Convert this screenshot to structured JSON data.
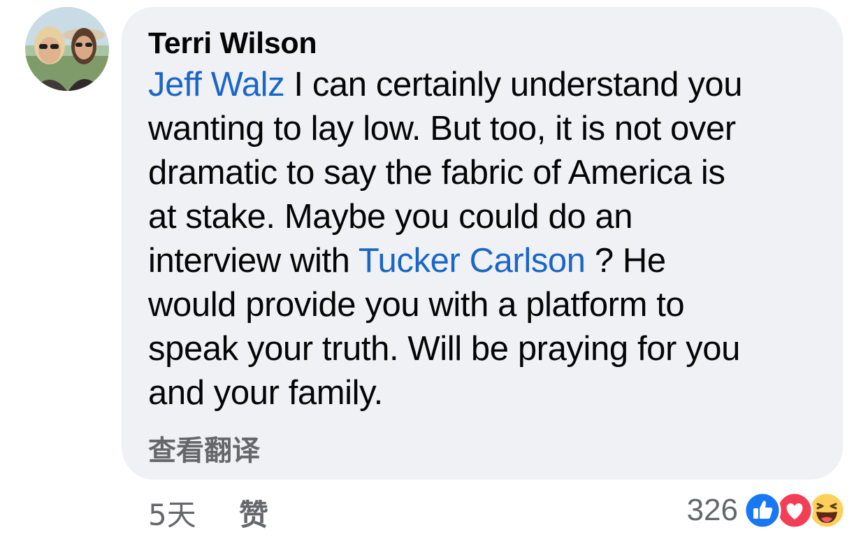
{
  "comment": {
    "author": "Terri Wilson",
    "body_lines": [
      [
        {
          "text": "Jeff Walz",
          "mention": true
        },
        {
          "text": " I can certainly understand you",
          "mention": false
        }
      ],
      [
        {
          "text": "wanting to lay low. But too, it is not over",
          "mention": false
        }
      ],
      [
        {
          "text": "dramatic to say the fabric of America is",
          "mention": false
        }
      ],
      [
        {
          "text": "at stake. Maybe you could do an",
          "mention": false
        }
      ],
      [
        {
          "text": "interview with ",
          "mention": false
        },
        {
          "text": "Tucker Carlson",
          "mention": true
        },
        {
          "text": " ? He",
          "mention": false
        }
      ],
      [
        {
          "text": "would provide you with a platform to",
          "mention": false
        }
      ],
      [
        {
          "text": "speak your truth. Will be praying for you",
          "mention": false
        }
      ],
      [
        {
          "text": "and your family.",
          "mention": false
        }
      ]
    ],
    "translate_label": "查看翻译"
  },
  "footer": {
    "time": "5天",
    "like_label": "赞",
    "reaction_count": "326",
    "reaction_icons": [
      "like-icon",
      "love-icon",
      "haha-icon"
    ]
  },
  "colors": {
    "mention": "#1a66c8",
    "bubble": "#eff1f5",
    "meta_text": "#65676b",
    "like_blue": "#1877f2",
    "love_red": "#f33e58",
    "haha_yellow": "#fcd05a"
  }
}
